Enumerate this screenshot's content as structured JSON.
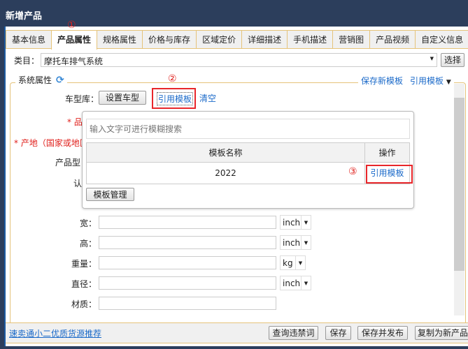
{
  "window": {
    "title": "新增产品"
  },
  "tabs": [
    {
      "label": "基本信息"
    },
    {
      "label": "产品属性",
      "active": true
    },
    {
      "label": "规格属性"
    },
    {
      "label": "价格与库存"
    },
    {
      "label": "区域定价"
    },
    {
      "label": "详细描述"
    },
    {
      "label": "手机描述"
    },
    {
      "label": "营销图"
    },
    {
      "label": "产品视频"
    },
    {
      "label": "自定义信息"
    }
  ],
  "annotations": {
    "step1": "①",
    "step2": "②",
    "step3": "③"
  },
  "category": {
    "label": "类目：",
    "value": "摩托车排气系统",
    "select_button": "选择"
  },
  "system_attrs": {
    "legend": "系统属性",
    "save_template": "保存新模板",
    "use_template": "引用模板",
    "refresh_icon": "refresh-icon"
  },
  "vehicle": {
    "label": "车型库：",
    "set_button": "设置车型",
    "use_template": "引用模板",
    "clear": "清空"
  },
  "behind_fields": {
    "brand": "* 品",
    "origin": "* 产地（国家或地区",
    "model": "产品型",
    "cert": "认"
  },
  "popup": {
    "search_placeholder": "输入文字可进行模糊搜索",
    "col_name": "模板名称",
    "col_action": "操作",
    "rows": [
      {
        "name": "2022",
        "action": "引用模板"
      }
    ],
    "manage_button": "模板管理"
  },
  "fields": [
    {
      "label": "宽：",
      "value": "",
      "unit": "inch"
    },
    {
      "label": "高：",
      "value": "",
      "unit": "inch"
    },
    {
      "label": "重量：",
      "value": "",
      "unit": "kg"
    },
    {
      "label": "直径：",
      "value": "",
      "unit": "inch"
    },
    {
      "label": "材质：",
      "value": ""
    }
  ],
  "footer": {
    "link": "速卖通小二优质货源推荐",
    "check": "查询违禁词",
    "save": "保存",
    "save_publish": "保存并发布",
    "copy": "复制为新产品"
  },
  "colors": {
    "titlebar": "#2c3e5c",
    "link": "#1b6ac9",
    "annotation": "#e8262a",
    "tab_border": "#e5c37a"
  }
}
